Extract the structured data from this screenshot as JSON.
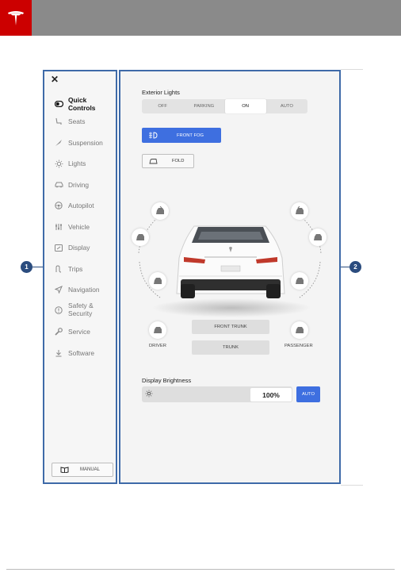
{
  "nav": {
    "close": "✕",
    "items": [
      {
        "label": "Quick Controls",
        "icon": "quick-controls-icon"
      },
      {
        "label": "Seats",
        "icon": "seat-icon"
      },
      {
        "label": "Suspension",
        "icon": "suspension-icon"
      },
      {
        "label": "Lights",
        "icon": "lights-icon"
      },
      {
        "label": "Driving",
        "icon": "driving-icon"
      },
      {
        "label": "Autopilot",
        "icon": "steering-wheel-icon"
      },
      {
        "label": "Vehicle",
        "icon": "sliders-icon"
      },
      {
        "label": "Display",
        "icon": "display-icon"
      },
      {
        "label": "Trips",
        "icon": "trips-icon"
      },
      {
        "label": "Navigation",
        "icon": "navigation-arrow-icon"
      },
      {
        "label": "Safety &\nSecurity",
        "icon": "info-circle-icon"
      },
      {
        "label": "Service",
        "icon": "wrench-icon"
      },
      {
        "label": "Software",
        "icon": "download-icon"
      }
    ],
    "active_index": 0,
    "manual_label": "MANUAL"
  },
  "exterior_lights": {
    "title": "Exterior Lights",
    "options": [
      "OFF",
      "PARKING",
      "ON",
      "AUTO"
    ],
    "selected": "ON"
  },
  "front_fog": {
    "label": "FRONT FOG",
    "active": true
  },
  "fold": {
    "label": "FOLD"
  },
  "controls": {
    "front_trunk": "FRONT TRUNK",
    "trunk": "TRUNK",
    "driver": "DRIVER",
    "passenger": "PASSENGER"
  },
  "brightness": {
    "title": "Display Brightness",
    "value_text": "100%",
    "level_percent": 100,
    "auto_label": "AUTO"
  },
  "callouts": [
    "1",
    "2"
  ],
  "colors": {
    "brand_red": "#cc0000",
    "accent_blue": "#3e6fe0",
    "callout_navy": "#2b4c7e",
    "outline_blue": "#3e6aa8"
  }
}
